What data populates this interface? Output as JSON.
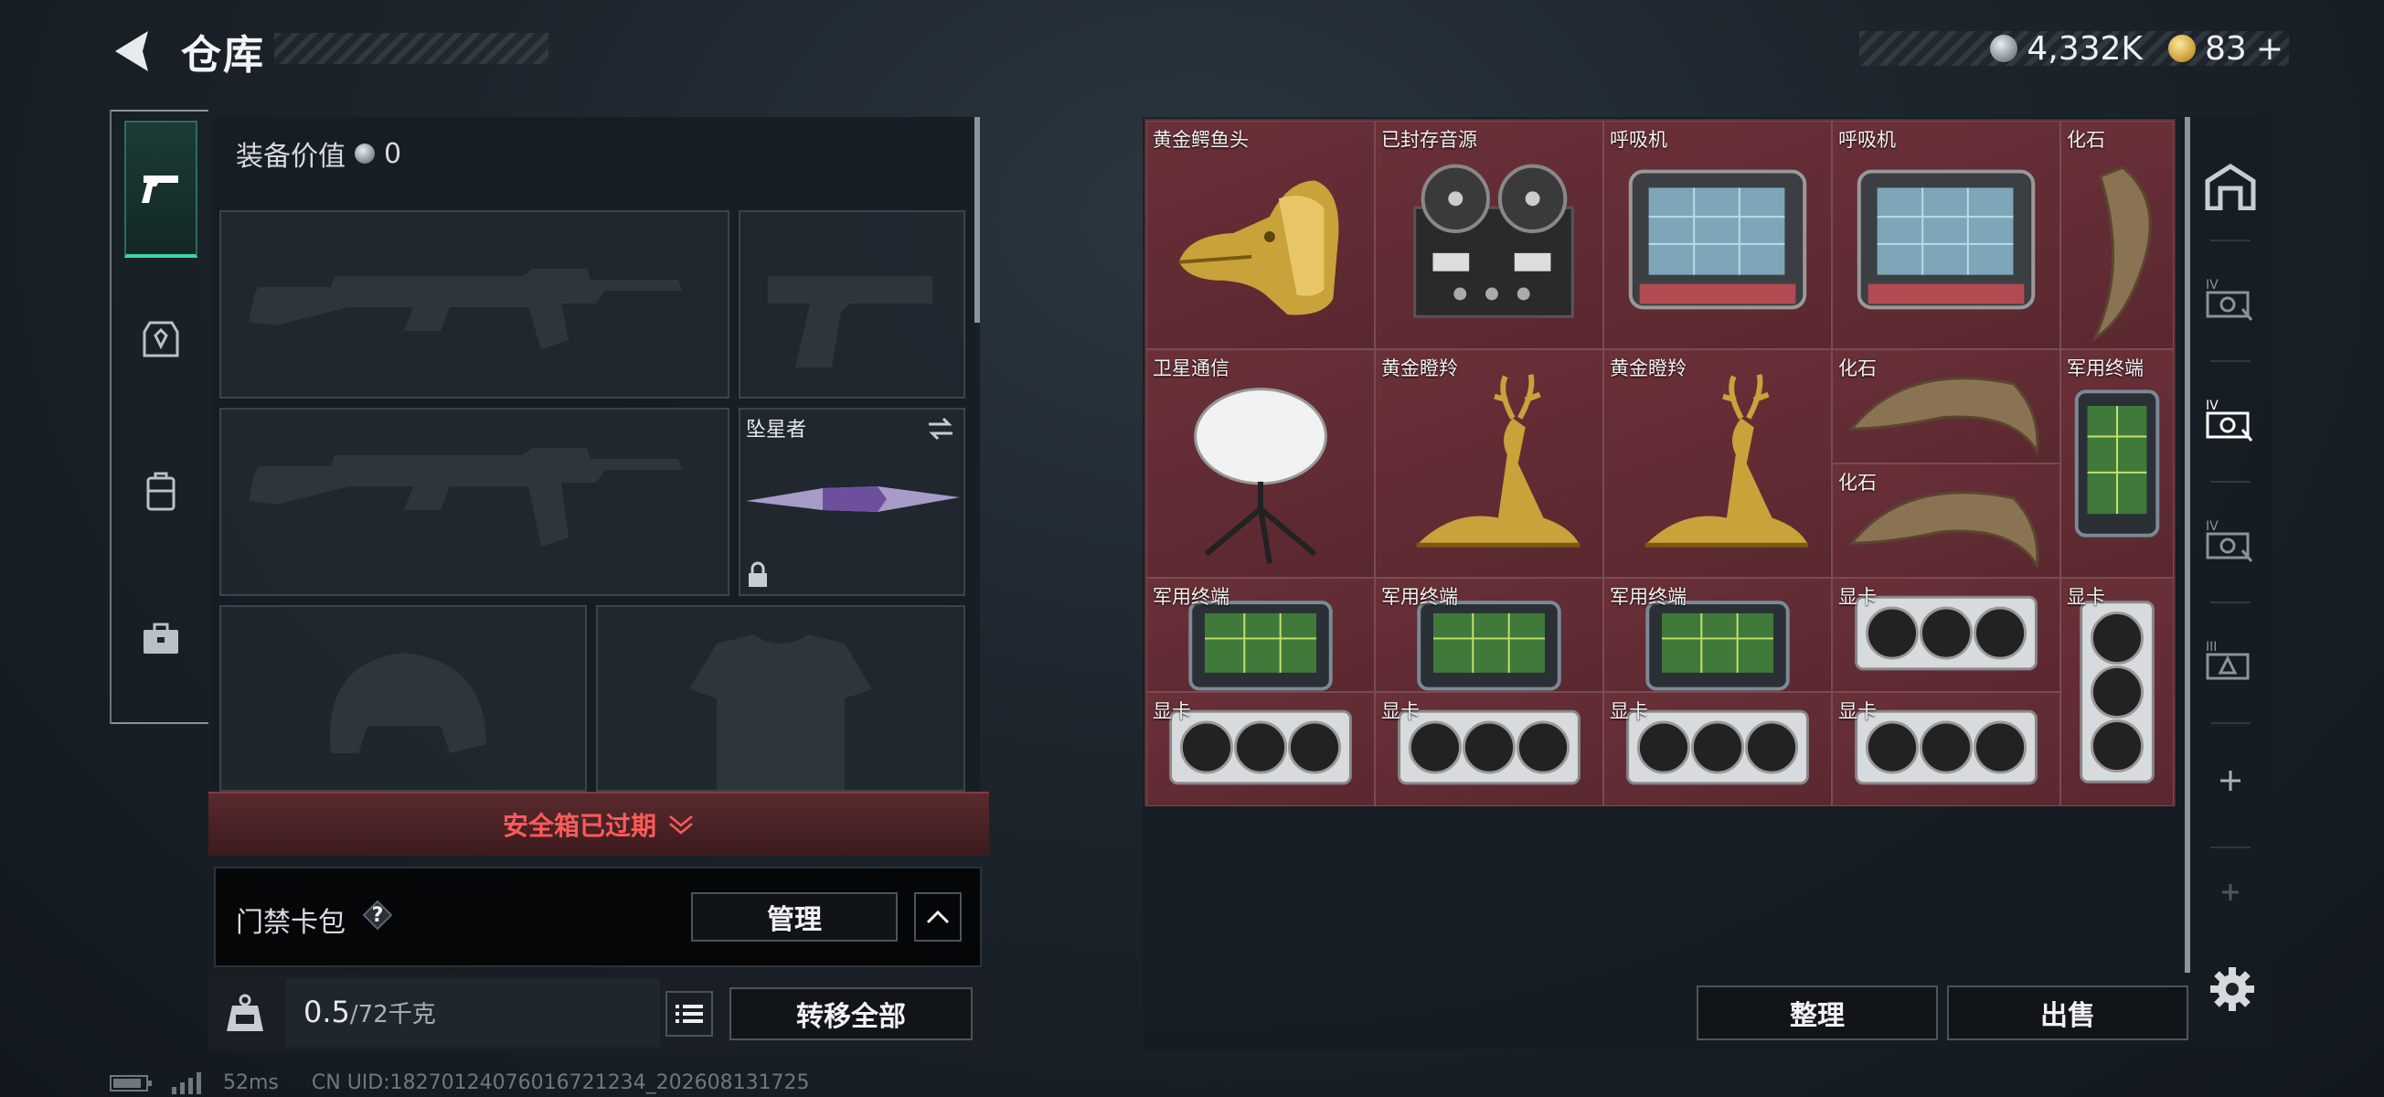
{
  "header": {
    "title": "仓库"
  },
  "currency": {
    "silver": "4,332K",
    "gold": "83",
    "gold_plus": "+"
  },
  "equipment": {
    "value_label": "装备价值",
    "value": "0",
    "melee_name": "坠星者"
  },
  "safe_box": {
    "status": "安全箱已过期"
  },
  "card_pack": {
    "label": "门禁卡包",
    "help": "?",
    "manage": "管理"
  },
  "capacity": {
    "current": "0.5",
    "max": "/72千克"
  },
  "actions": {
    "transfer_all": "转移全部",
    "sort": "整理",
    "sell": "出售"
  },
  "footer": {
    "ping": "52ms",
    "uid": "CN UID:18270124076016721234_202608131725"
  },
  "stash_items": [
    {
      "name": "黄金鳄鱼头",
      "icon": "gold-crocodile-head"
    },
    {
      "name": "已封存音源",
      "icon": "reel-recorder"
    },
    {
      "name": "呼吸机",
      "icon": "ventilator"
    },
    {
      "name": "呼吸机",
      "icon": "ventilator"
    },
    {
      "name": "化石",
      "icon": "fossil-claw"
    },
    {
      "name": "卫星通信",
      "icon": "satellite-dish"
    },
    {
      "name": "黄金瞪羚",
      "icon": "gold-gazelle"
    },
    {
      "name": "黄金瞪羚",
      "icon": "gold-gazelle"
    },
    {
      "name": "化石",
      "icon": "fossil-claw"
    },
    {
      "name": "化石",
      "icon": "fossil-claw"
    },
    {
      "name": "军用终端",
      "icon": "military-terminal"
    },
    {
      "name": "军用终端",
      "icon": "military-terminal"
    },
    {
      "name": "军用终端",
      "icon": "military-terminal"
    },
    {
      "name": "军用终端",
      "icon": "military-terminal"
    },
    {
      "name": "显卡",
      "icon": "graphics-card"
    },
    {
      "name": "显卡",
      "icon": "graphics-card"
    },
    {
      "name": "显卡",
      "icon": "graphics-card"
    },
    {
      "name": "显卡",
      "icon": "graphics-card"
    },
    {
      "name": "显卡",
      "icon": "graphics-card"
    },
    {
      "name": "显卡",
      "icon": "graphics-card"
    }
  ],
  "colors": {
    "accent": "#3cd6a4",
    "danger": "#ff5a5a",
    "stash_bg": "#5a2a30"
  }
}
